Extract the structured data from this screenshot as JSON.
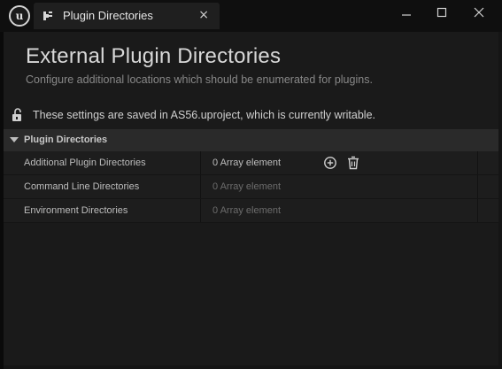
{
  "titlebar": {
    "app_logo_letter": "u",
    "tab_label": "Plugin Directories",
    "tab_close": "×",
    "minimize_icon": "minimize-icon",
    "maximize_icon": "maximize-icon",
    "close_icon": "close-icon"
  },
  "header": {
    "title": "External Plugin Directories",
    "subtitle": "Configure additional locations which should be enumerated for plugins."
  },
  "status": {
    "icon": "unlock-icon",
    "text": "These settings are saved in AS56.uproject, which is currently writable."
  },
  "category": {
    "label": "Plugin Directories",
    "expanded": true
  },
  "properties": [
    {
      "name": "Additional Plugin Directories",
      "value": "0 Array element",
      "has_actions": true
    },
    {
      "name": "Command Line Directories",
      "value": "0 Array element",
      "has_actions": false
    },
    {
      "name": "Environment Directories",
      "value": "0 Array element",
      "has_actions": false
    }
  ],
  "colors": {
    "background": "#1a1a1a",
    "titlebar": "#0f0f0f",
    "category_header": "#2a2a2a",
    "text_primary": "#d8d8d8",
    "text_dim": "#6c6c6c"
  }
}
